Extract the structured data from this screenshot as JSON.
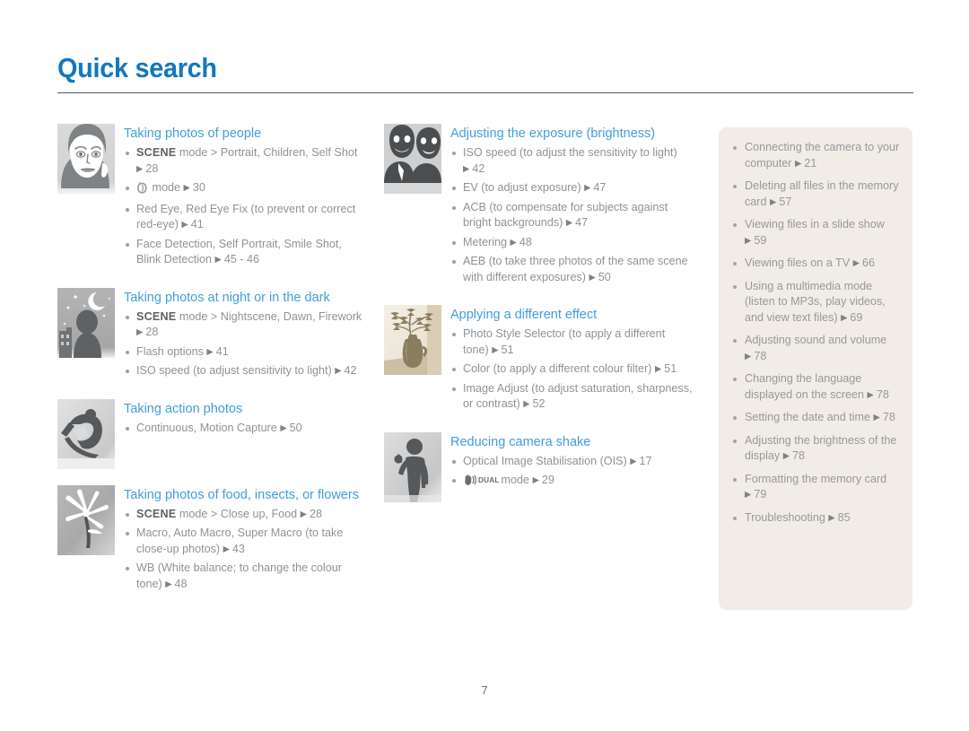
{
  "header": {
    "title": "Quick search"
  },
  "page_number": "7",
  "colors": {
    "title_blue": "#1278be",
    "heading_blue": "#3f9fdb",
    "body_grey": "#8e9395",
    "panel_bg": "#f1ece6",
    "rule": "#555a5e"
  },
  "left_column": [
    {
      "thumb": "portrait-woman-thumbnail",
      "heading": "Taking photos of people",
      "items": [
        {
          "parts": [
            {
              "t": "kw",
              "v": "SCENE"
            },
            {
              "t": "txt",
              "v": " mode > Portrait, Children, Self Shot "
            },
            {
              "t": "pg",
              "v": "28"
            }
          ]
        },
        {
          "parts": [
            {
              "t": "icon",
              "v": "self-shot-mode-icon"
            },
            {
              "t": "txt",
              "v": " mode "
            },
            {
              "t": "pg",
              "v": "30"
            }
          ]
        },
        {
          "parts": [
            {
              "t": "txt",
              "v": "Red Eye, Red Eye Fix (to prevent or correct red-eye) "
            },
            {
              "t": "pg",
              "v": "41"
            }
          ]
        },
        {
          "parts": [
            {
              "t": "txt",
              "v": "Face Detection, Self Portrait, Smile Shot, Blink Detection "
            },
            {
              "t": "pg",
              "v": "45 - 46"
            }
          ]
        }
      ]
    },
    {
      "thumb": "night-scene-thumbnail",
      "heading": "Taking photos at night or in the dark",
      "items": [
        {
          "parts": [
            {
              "t": "kw",
              "v": "SCENE"
            },
            {
              "t": "txt",
              "v": " mode > Nightscene, Dawn, Firework "
            },
            {
              "t": "pg",
              "v": "28"
            }
          ]
        },
        {
          "parts": [
            {
              "t": "txt",
              "v": "Flash options "
            },
            {
              "t": "pg",
              "v": "41"
            }
          ]
        },
        {
          "parts": [
            {
              "t": "txt",
              "v": "ISO speed (to adjust sensitivity to light) "
            },
            {
              "t": "pg",
              "v": "42"
            }
          ]
        }
      ]
    },
    {
      "thumb": "snowboarder-thumbnail",
      "heading": "Taking action photos",
      "items": [
        {
          "parts": [
            {
              "t": "txt",
              "v": "Continuous, Motion Capture "
            },
            {
              "t": "pg",
              "v": "50"
            }
          ]
        }
      ]
    },
    {
      "thumb": "flower-thumbnail",
      "heading": "Taking photos of food, insects, or flowers",
      "items": [
        {
          "parts": [
            {
              "t": "kw",
              "v": "SCENE"
            },
            {
              "t": "txt",
              "v": " mode > Close up, Food "
            },
            {
              "t": "pg",
              "v": "28"
            }
          ]
        },
        {
          "parts": [
            {
              "t": "txt",
              "v": "Macro, Auto Macro, Super Macro (to take close-up photos) "
            },
            {
              "t": "pg",
              "v": "43"
            }
          ]
        },
        {
          "parts": [
            {
              "t": "txt",
              "v": "WB (White balance; to change the colour tone) "
            },
            {
              "t": "pg",
              "v": "48"
            }
          ]
        }
      ]
    }
  ],
  "middle_column": [
    {
      "thumb": "two-people-smiling-thumbnail",
      "heading": "Adjusting the exposure (brightness)",
      "items": [
        {
          "parts": [
            {
              "t": "txt",
              "v": "ISO speed (to adjust the sensitivity to light) "
            },
            {
              "t": "pg",
              "v": "42"
            }
          ]
        },
        {
          "parts": [
            {
              "t": "txt",
              "v": "EV (to adjust exposure) "
            },
            {
              "t": "pg",
              "v": "47"
            }
          ]
        },
        {
          "parts": [
            {
              "t": "txt",
              "v": "ACB (to compensate for subjects against bright backgrounds) "
            },
            {
              "t": "pg",
              "v": "47"
            }
          ]
        },
        {
          "parts": [
            {
              "t": "txt",
              "v": "Metering "
            },
            {
              "t": "pg",
              "v": "48"
            }
          ]
        },
        {
          "parts": [
            {
              "t": "txt",
              "v": "AEB (to take three photos of the same scene with different exposures) "
            },
            {
              "t": "pg",
              "v": "50"
            }
          ]
        }
      ]
    },
    {
      "thumb": "vase-with-branches-thumbnail",
      "heading": "Applying a different effect",
      "items": [
        {
          "parts": [
            {
              "t": "txt",
              "v": "Photo Style Selector (to apply a different tone) "
            },
            {
              "t": "pg",
              "v": "51"
            }
          ]
        },
        {
          "parts": [
            {
              "t": "txt",
              "v": "Color (to apply a different colour filter) "
            },
            {
              "t": "pg",
              "v": "51"
            }
          ]
        },
        {
          "parts": [
            {
              "t": "txt",
              "v": "Image Adjust (to adjust saturation, sharpness, or contrast) "
            },
            {
              "t": "pg",
              "v": "52"
            }
          ]
        }
      ]
    },
    {
      "thumb": "person-waving-thumbnail",
      "heading": "Reducing camera shake",
      "items": [
        {
          "parts": [
            {
              "t": "txt",
              "v": "Optical Image Stabilisation (OIS) "
            },
            {
              "t": "pg",
              "v": "17"
            }
          ]
        },
        {
          "parts": [
            {
              "t": "icon",
              "v": "dual-is-icon"
            },
            {
              "t": "dual",
              "v": "DUAL"
            },
            {
              "t": "txt",
              "v": "mode "
            },
            {
              "t": "pg",
              "v": "29"
            }
          ]
        }
      ]
    }
  ],
  "side_panel": {
    "items": [
      {
        "parts": [
          {
            "t": "txt",
            "v": "Connecting the camera to your computer "
          },
          {
            "t": "pg",
            "v": "21"
          }
        ]
      },
      {
        "parts": [
          {
            "t": "txt",
            "v": "Deleting all files in the memory card "
          },
          {
            "t": "pg",
            "v": "57"
          }
        ]
      },
      {
        "parts": [
          {
            "t": "txt",
            "v": "Viewing files in a slide show "
          },
          {
            "t": "pg",
            "v": "59"
          }
        ]
      },
      {
        "parts": [
          {
            "t": "txt",
            "v": "Viewing files on a TV "
          },
          {
            "t": "pg",
            "v": "66"
          }
        ]
      },
      {
        "parts": [
          {
            "t": "txt",
            "v": "Using a multimedia mode (listen to MP3s, play videos, and view text files) "
          },
          {
            "t": "pg",
            "v": "69"
          }
        ]
      },
      {
        "parts": [
          {
            "t": "txt",
            "v": "Adjusting sound and volume "
          },
          {
            "t": "pg",
            "v": "78"
          }
        ]
      },
      {
        "parts": [
          {
            "t": "txt",
            "v": "Changing the language displayed on the screen "
          },
          {
            "t": "pg",
            "v": "78"
          }
        ]
      },
      {
        "parts": [
          {
            "t": "txt",
            "v": "Setting the date and time "
          },
          {
            "t": "pg",
            "v": "78"
          }
        ]
      },
      {
        "parts": [
          {
            "t": "txt",
            "v": "Adjusting the brightness of the display "
          },
          {
            "t": "pg",
            "v": "78"
          }
        ]
      },
      {
        "parts": [
          {
            "t": "txt",
            "v": "Formatting the memory card "
          },
          {
            "t": "pg",
            "v": "79"
          }
        ]
      },
      {
        "parts": [
          {
            "t": "txt",
            "v": "Troubleshooting "
          },
          {
            "t": "pg",
            "v": "85"
          }
        ]
      }
    ]
  }
}
